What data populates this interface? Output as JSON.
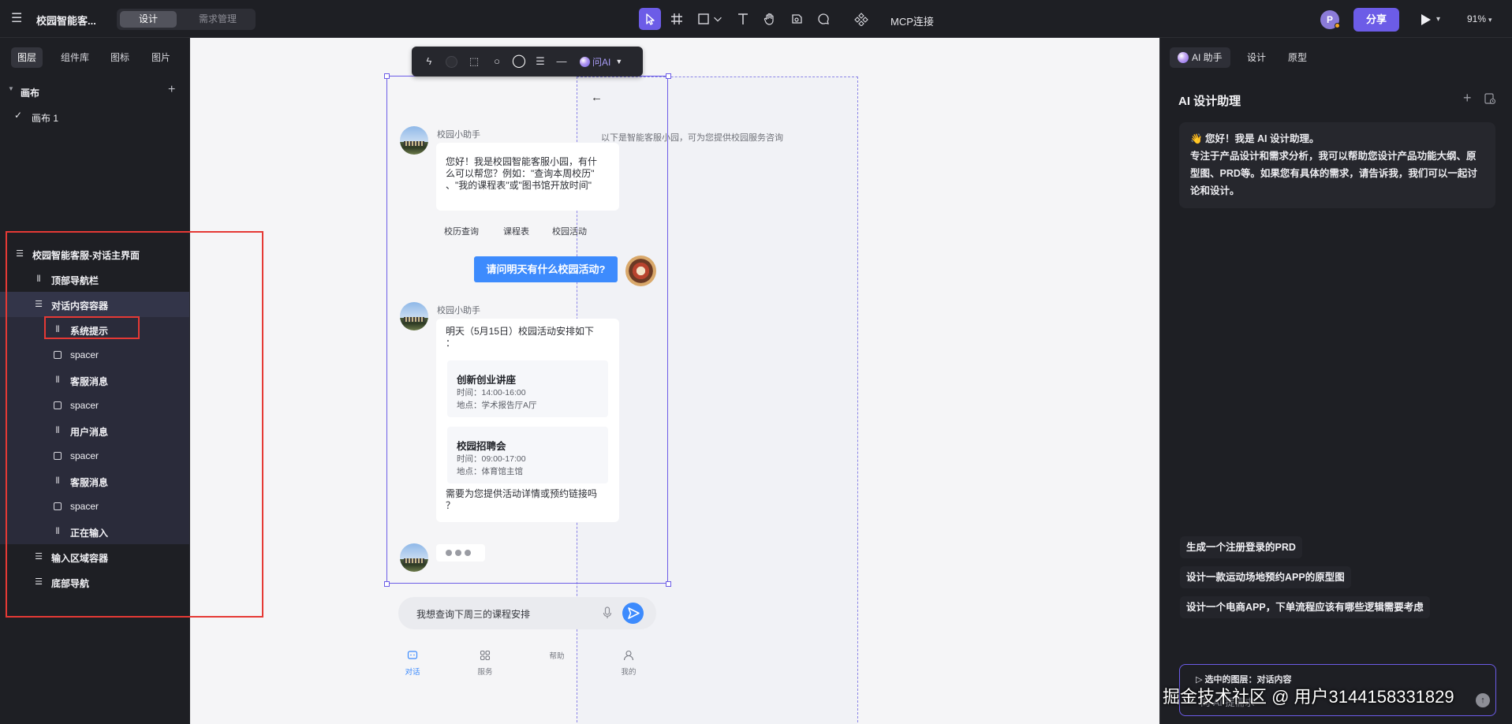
{
  "app": {
    "title": "校园智能客...",
    "modes": [
      "设计",
      "需求管理"
    ],
    "active_mode": "设计"
  },
  "toolbar": {
    "mcp_label": "MCP连接",
    "avatar_letter": "P",
    "share_label": "分享",
    "zoom": "91%"
  },
  "left_panel": {
    "tabs": [
      "图层",
      "组件库",
      "图标",
      "图片"
    ],
    "canvas_section": "画布",
    "canvas_item": "画布 1",
    "layers": [
      {
        "label": "校园智能客服-对话主界面",
        "icon": "list-icon"
      },
      {
        "label": "顶部导航栏",
        "icon": "columns-icon"
      },
      {
        "label": "对话内容容器",
        "icon": "list-icon"
      },
      {
        "label": "系统提示",
        "icon": "columns-icon"
      },
      {
        "label": "spacer",
        "icon": "square-icon"
      },
      {
        "label": "客服消息",
        "icon": "columns-icon"
      },
      {
        "label": "spacer",
        "icon": "square-icon"
      },
      {
        "label": "用户消息",
        "icon": "columns-icon"
      },
      {
        "label": "spacer",
        "icon": "square-icon"
      },
      {
        "label": "客服消息",
        "icon": "columns-icon"
      },
      {
        "label": "spacer",
        "icon": "square-icon"
      },
      {
        "label": "正在输入",
        "icon": "columns-icon"
      },
      {
        "label": "输入区域容器",
        "icon": "list-icon"
      },
      {
        "label": "底部导航",
        "icon": "list-icon"
      }
    ]
  },
  "float_toolbar": {
    "ask_ai": "问AI"
  },
  "phone": {
    "system_tip": "以下是智能客服小园，可为您提供校园服务咨询",
    "bot_name": "校园小助手",
    "welcome": [
      "您好！我是校园智能客服小园，有什",
      "么可以帮您？例如：\"查询本周校历\"",
      "、\"我的课程表\"或\"图书馆开放时间\""
    ],
    "quick_replies": [
      "校历查询",
      "课程表",
      "校园活动"
    ],
    "user_message": "请问明天有什么校园活动?",
    "reply_intro": [
      "明天（5月15日）校园活动安排如下",
      "："
    ],
    "events": [
      {
        "title": "创新创业讲座",
        "time": "时间：14:00-16:00",
        "place": "地点：学术报告厅A厅"
      },
      {
        "title": "校园招聘会",
        "time": "时间：09:00-17:00",
        "place": "地点：体育馆主馆"
      }
    ],
    "reply_outro": [
      "需要为您提供活动详情或预约链接吗",
      "？"
    ],
    "input_text": "我想查询下周三的课程安排",
    "nav": [
      "对话",
      "服务",
      "帮助",
      "我的"
    ]
  },
  "right_panel": {
    "tabs": [
      "AI 助手",
      "设计",
      "原型"
    ],
    "title": "AI 设计助理",
    "greeting": [
      "👋 您好！我是 AI 设计助理。",
      "专注于产品设计和需求分析，我可以帮助您设计产品功能大纲、原",
      "型图、PRD等。如果您有具体的需求，请告诉我，我们可以一起讨",
      "论和设计。"
    ],
    "suggestions": [
      "生成一个注册登录的PRD",
      "设计一款运动场地预约APP的原型图",
      "设计一个电商APP，下单流程应该有哪些逻辑需要考虑"
    ],
    "selected_layer": "▷ 选中的图层：对话内容",
    "input_placeholder": "向 AI 提需求"
  },
  "watermark": "掘金技术社区 @ 用户3144158331829",
  "colors": {
    "accent": "#6c5ce7",
    "blue": "#3d8bfd",
    "highlight_box": "#e53935"
  }
}
